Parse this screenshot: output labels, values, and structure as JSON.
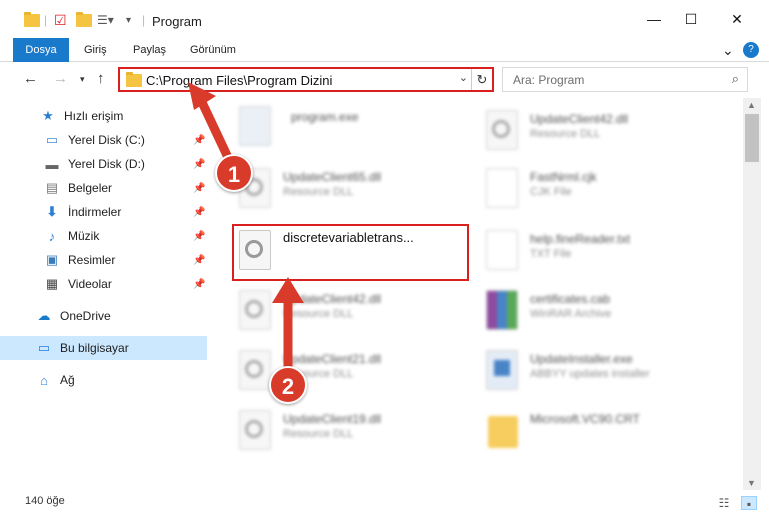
{
  "window": {
    "title": "Program",
    "minimize": "—",
    "maximize": "☐",
    "close": "✕"
  },
  "ribbon": {
    "tabs": [
      "Dosya",
      "Giriş",
      "Paylaş",
      "Görünüm"
    ],
    "expand": "⌄",
    "help": "?"
  },
  "address": {
    "path": "C:\\Program Files\\Program Dizini",
    "search_placeholder": "Ara: Program"
  },
  "sidebar": {
    "items": [
      {
        "label": "Hızlı erişim",
        "icon": "star-icon"
      },
      {
        "label": "Yerel Disk (C:)",
        "icon": "drive-icon"
      },
      {
        "label": "Yerel Disk (D:)",
        "icon": "drive-icon"
      },
      {
        "label": "Belgeler",
        "icon": "documents-icon"
      },
      {
        "label": "İndirmeler",
        "icon": "download-icon"
      },
      {
        "label": "Müzik",
        "icon": "music-icon"
      },
      {
        "label": "Resimler",
        "icon": "pictures-icon"
      },
      {
        "label": "Videolar",
        "icon": "video-icon"
      },
      {
        "label": "OneDrive",
        "icon": "cloud-icon"
      },
      {
        "label": "Bu bilgisayar",
        "icon": "computer-icon"
      },
      {
        "label": "Ağ",
        "icon": "network-icon"
      }
    ]
  },
  "files": [
    {
      "name": "program.exe",
      "sub": ""
    },
    {
      "name": "UpdateClient42.dll",
      "sub": "Resource DLL"
    },
    {
      "name": "UpdateClient65.dll",
      "sub": "Resource DLL"
    },
    {
      "name": "FastNrml.cjk",
      "sub": "CJK File"
    },
    {
      "name": "discretevariabletrans...",
      "sub": ""
    },
    {
      "name": "help.fineReader.txt",
      "sub": "TXT File"
    },
    {
      "name": "UpdateClient42.dll",
      "sub": "Resource DLL"
    },
    {
      "name": "certificates.cab",
      "sub": "WinRAR Archive"
    },
    {
      "name": "UpdateClient21.dll",
      "sub": "Resource DLL"
    },
    {
      "name": "UpdateInstaller.exe",
      "sub": "ABBYY updates installer"
    },
    {
      "name": "UpdateClient19.dll",
      "sub": "Resource DLL"
    },
    {
      "name": "Microsoft.VC90.CRT",
      "sub": ""
    }
  ],
  "status": {
    "count": "140 öğe"
  },
  "annotations": {
    "step1": "1",
    "step2": "2"
  },
  "colors": {
    "accent": "#1979ca",
    "highlight": "#d9201f",
    "badge": "#d93b2b",
    "selected": "#cce8ff"
  }
}
